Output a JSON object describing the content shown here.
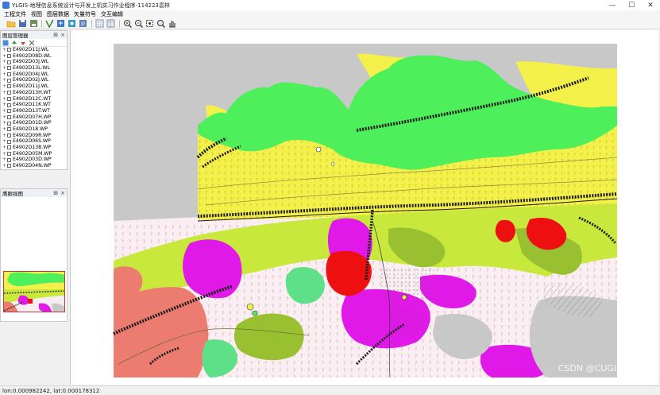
{
  "window": {
    "title": "YLGIS-地理信息系统设计与开发上机实习作业程序-114223袁林",
    "controls": [
      "—",
      "☐",
      "✕"
    ]
  },
  "menu": [
    "工程文件",
    "视图",
    "图层数据",
    "矢量符号",
    "交互编辑"
  ],
  "toolbar": {
    "icons": [
      "open-folder-icon",
      "save-icon",
      "save-as-icon",
      "vector-icon",
      "add-layer-icon",
      "remove-layer-icon",
      "layer-props-icon",
      "grid-icon",
      "table-icon",
      "zoom-in-icon",
      "zoom-out-icon",
      "full-extent-icon",
      "zoom-window-icon",
      "pan-hand-icon"
    ]
  },
  "layers_panel": {
    "title": "图层管理器",
    "layers": [
      "E4902D11J.WL",
      "E4902D08D.WL",
      "E4902D03J.WL",
      "E4902D13L.WL",
      "E4902D04J.WL",
      "E4902D02J.WL",
      "E4902D11J.WL",
      "E4902D13H.WT",
      "E4902D12C.WT",
      "E4902D11K.WT",
      "E4902D13T.WT",
      "E4902D07H.WP",
      "E4902D01D.WP",
      "E4902D18.WP",
      "E4902D09R.WP",
      "E4902D06S.WP",
      "E4902D13B.WP",
      "E4902D05M.WP",
      "E4902D03D.WP",
      "E4902D04N.WP"
    ]
  },
  "overview_panel": {
    "title": "鹰眼视图"
  },
  "status": {
    "coords": "lon:0.000982242, lat:0.000178312"
  },
  "watermark": "CSDN @CUGLin",
  "colors": {
    "bright_green": "#4df05a",
    "yellow": "#f4f04a",
    "lime": "#c8e83c",
    "magenta": "#e018e8",
    "red": "#ee1010",
    "salmon": "#ec7c70",
    "pale_pink": "#fbeef2",
    "gray": "#c8c8c8",
    "olive": "#98c030"
  }
}
